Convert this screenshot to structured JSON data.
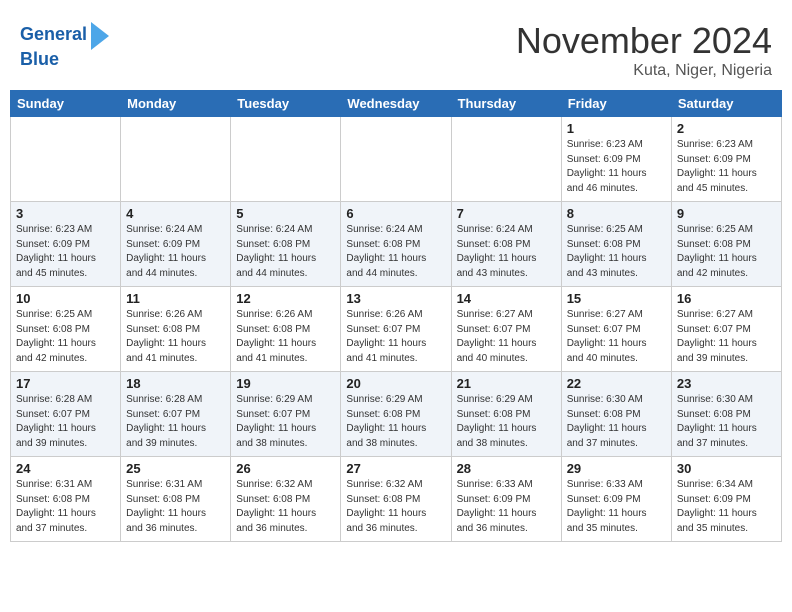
{
  "header": {
    "logo_line1": "General",
    "logo_line2": "Blue",
    "month": "November 2024",
    "location": "Kuta, Niger, Nigeria"
  },
  "weekdays": [
    "Sunday",
    "Monday",
    "Tuesday",
    "Wednesday",
    "Thursday",
    "Friday",
    "Saturday"
  ],
  "weeks": [
    [
      {
        "day": "",
        "info": ""
      },
      {
        "day": "",
        "info": ""
      },
      {
        "day": "",
        "info": ""
      },
      {
        "day": "",
        "info": ""
      },
      {
        "day": "",
        "info": ""
      },
      {
        "day": "1",
        "info": "Sunrise: 6:23 AM\nSunset: 6:09 PM\nDaylight: 11 hours\nand 46 minutes."
      },
      {
        "day": "2",
        "info": "Sunrise: 6:23 AM\nSunset: 6:09 PM\nDaylight: 11 hours\nand 45 minutes."
      }
    ],
    [
      {
        "day": "3",
        "info": "Sunrise: 6:23 AM\nSunset: 6:09 PM\nDaylight: 11 hours\nand 45 minutes."
      },
      {
        "day": "4",
        "info": "Sunrise: 6:24 AM\nSunset: 6:09 PM\nDaylight: 11 hours\nand 44 minutes."
      },
      {
        "day": "5",
        "info": "Sunrise: 6:24 AM\nSunset: 6:08 PM\nDaylight: 11 hours\nand 44 minutes."
      },
      {
        "day": "6",
        "info": "Sunrise: 6:24 AM\nSunset: 6:08 PM\nDaylight: 11 hours\nand 44 minutes."
      },
      {
        "day": "7",
        "info": "Sunrise: 6:24 AM\nSunset: 6:08 PM\nDaylight: 11 hours\nand 43 minutes."
      },
      {
        "day": "8",
        "info": "Sunrise: 6:25 AM\nSunset: 6:08 PM\nDaylight: 11 hours\nand 43 minutes."
      },
      {
        "day": "9",
        "info": "Sunrise: 6:25 AM\nSunset: 6:08 PM\nDaylight: 11 hours\nand 42 minutes."
      }
    ],
    [
      {
        "day": "10",
        "info": "Sunrise: 6:25 AM\nSunset: 6:08 PM\nDaylight: 11 hours\nand 42 minutes."
      },
      {
        "day": "11",
        "info": "Sunrise: 6:26 AM\nSunset: 6:08 PM\nDaylight: 11 hours\nand 41 minutes."
      },
      {
        "day": "12",
        "info": "Sunrise: 6:26 AM\nSunset: 6:08 PM\nDaylight: 11 hours\nand 41 minutes."
      },
      {
        "day": "13",
        "info": "Sunrise: 6:26 AM\nSunset: 6:07 PM\nDaylight: 11 hours\nand 41 minutes."
      },
      {
        "day": "14",
        "info": "Sunrise: 6:27 AM\nSunset: 6:07 PM\nDaylight: 11 hours\nand 40 minutes."
      },
      {
        "day": "15",
        "info": "Sunrise: 6:27 AM\nSunset: 6:07 PM\nDaylight: 11 hours\nand 40 minutes."
      },
      {
        "day": "16",
        "info": "Sunrise: 6:27 AM\nSunset: 6:07 PM\nDaylight: 11 hours\nand 39 minutes."
      }
    ],
    [
      {
        "day": "17",
        "info": "Sunrise: 6:28 AM\nSunset: 6:07 PM\nDaylight: 11 hours\nand 39 minutes."
      },
      {
        "day": "18",
        "info": "Sunrise: 6:28 AM\nSunset: 6:07 PM\nDaylight: 11 hours\nand 39 minutes."
      },
      {
        "day": "19",
        "info": "Sunrise: 6:29 AM\nSunset: 6:07 PM\nDaylight: 11 hours\nand 38 minutes."
      },
      {
        "day": "20",
        "info": "Sunrise: 6:29 AM\nSunset: 6:08 PM\nDaylight: 11 hours\nand 38 minutes."
      },
      {
        "day": "21",
        "info": "Sunrise: 6:29 AM\nSunset: 6:08 PM\nDaylight: 11 hours\nand 38 minutes."
      },
      {
        "day": "22",
        "info": "Sunrise: 6:30 AM\nSunset: 6:08 PM\nDaylight: 11 hours\nand 37 minutes."
      },
      {
        "day": "23",
        "info": "Sunrise: 6:30 AM\nSunset: 6:08 PM\nDaylight: 11 hours\nand 37 minutes."
      }
    ],
    [
      {
        "day": "24",
        "info": "Sunrise: 6:31 AM\nSunset: 6:08 PM\nDaylight: 11 hours\nand 37 minutes."
      },
      {
        "day": "25",
        "info": "Sunrise: 6:31 AM\nSunset: 6:08 PM\nDaylight: 11 hours\nand 36 minutes."
      },
      {
        "day": "26",
        "info": "Sunrise: 6:32 AM\nSunset: 6:08 PM\nDaylight: 11 hours\nand 36 minutes."
      },
      {
        "day": "27",
        "info": "Sunrise: 6:32 AM\nSunset: 6:08 PM\nDaylight: 11 hours\nand 36 minutes."
      },
      {
        "day": "28",
        "info": "Sunrise: 6:33 AM\nSunset: 6:09 PM\nDaylight: 11 hours\nand 36 minutes."
      },
      {
        "day": "29",
        "info": "Sunrise: 6:33 AM\nSunset: 6:09 PM\nDaylight: 11 hours\nand 35 minutes."
      },
      {
        "day": "30",
        "info": "Sunrise: 6:34 AM\nSunset: 6:09 PM\nDaylight: 11 hours\nand 35 minutes."
      }
    ]
  ]
}
